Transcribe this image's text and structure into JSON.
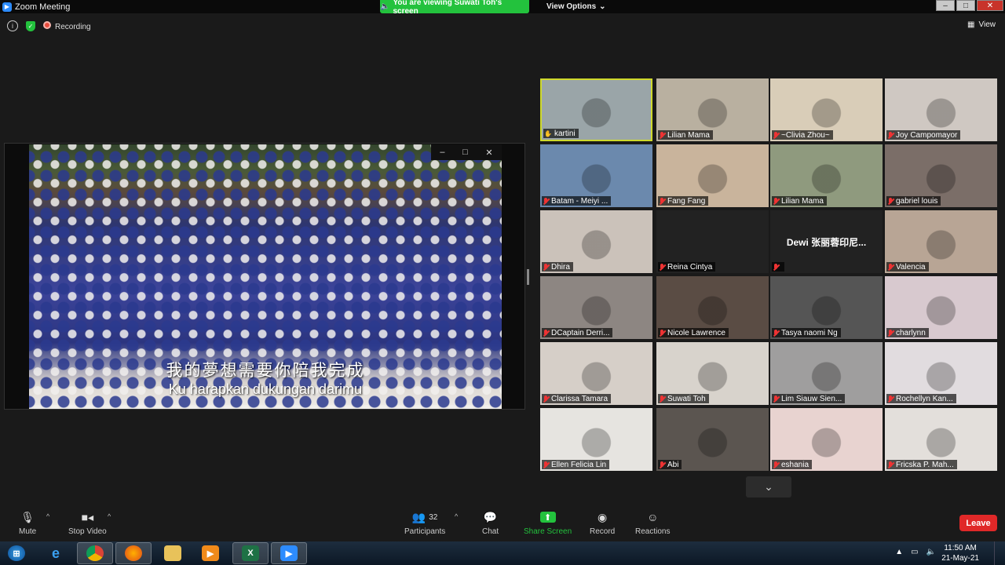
{
  "window": {
    "title": "Zoom Meeting"
  },
  "banner": {
    "viewing": "You are viewing Suwati Toh's screen",
    "view_options": "View Options"
  },
  "infobar": {
    "recording": "Recording",
    "view": "View"
  },
  "share": {
    "subtitle_zh": "我的夢想需要你陪我完成",
    "subtitle_id": "Ku harapkan dukungan darimu"
  },
  "participants": [
    {
      "name": "kartini",
      "muted": false,
      "active": true,
      "bg": "#9aa5a8"
    },
    {
      "name": "Lilian Mama",
      "muted": true,
      "bg": "#b9b0a0"
    },
    {
      "name": "~Clivia Zhou~",
      "muted": true,
      "bg": "#d9cdb8"
    },
    {
      "name": "Joy Campomayor",
      "muted": true,
      "bg": "#cfc8c2"
    },
    {
      "name": "Batam - Meiyi ...",
      "muted": true,
      "bg": "#6b89ad"
    },
    {
      "name": "Fang Fang",
      "muted": true,
      "bg": "#c9b49c"
    },
    {
      "name": "Lilian Mama",
      "muted": true,
      "bg": "#8f9a7e"
    },
    {
      "name": "gabriel louis",
      "muted": true,
      "bg": "#7b6e68"
    },
    {
      "name": "Dhira",
      "muted": true,
      "bg": "#cbc2ba"
    },
    {
      "name": "Reina Cintya",
      "muted": true,
      "bg": "#222222"
    },
    {
      "name": "",
      "display": "Dewi 张丽蓉印尼...",
      "muted": true,
      "bg": "#222222"
    },
    {
      "name": "Valencia",
      "muted": true,
      "bg": "#b8a595"
    },
    {
      "name": "DCaptain Derri...",
      "muted": true,
      "bg": "#8d8682"
    },
    {
      "name": "Nicole Lawrence",
      "muted": true,
      "bg": "#5a4c44"
    },
    {
      "name": "Tasya naomi Ng",
      "muted": true,
      "bg": "#555555"
    },
    {
      "name": "charlynn",
      "muted": true,
      "bg": "#d8c9cf"
    },
    {
      "name": "Clarissa Tamara",
      "muted": true,
      "bg": "#d6cfc8"
    },
    {
      "name": "Suwati Toh",
      "muted": true,
      "bg": "#d8d3cc"
    },
    {
      "name": "Lim Siauw Sien...",
      "muted": true,
      "bg": "#9f9e9e"
    },
    {
      "name": "Rochellyn Kan...",
      "muted": true,
      "bg": "#e1dcdf"
    },
    {
      "name": "Ellen Felicia Lin",
      "muted": true,
      "bg": "#e6e4e0"
    },
    {
      "name": "Abi",
      "muted": true,
      "bg": "#5b5550"
    },
    {
      "name": "eshania",
      "muted": true,
      "bg": "#e8d3d0"
    },
    {
      "name": "Fricska P. Mah...",
      "muted": true,
      "bg": "#e3dfdb"
    }
  ],
  "toolbar": {
    "mute": "Mute",
    "stop_video": "Stop Video",
    "participants": "Participants",
    "participants_count": "32",
    "chat": "Chat",
    "share_screen": "Share Screen",
    "record": "Record",
    "reactions": "Reactions",
    "leave": "Leave"
  },
  "taskbar": {
    "time": "11:50 AM",
    "date": "21-May-21"
  },
  "colors": {
    "accent_green": "#23c23d",
    "leave_red": "#e02828",
    "active_speaker": "#cfd92c"
  }
}
